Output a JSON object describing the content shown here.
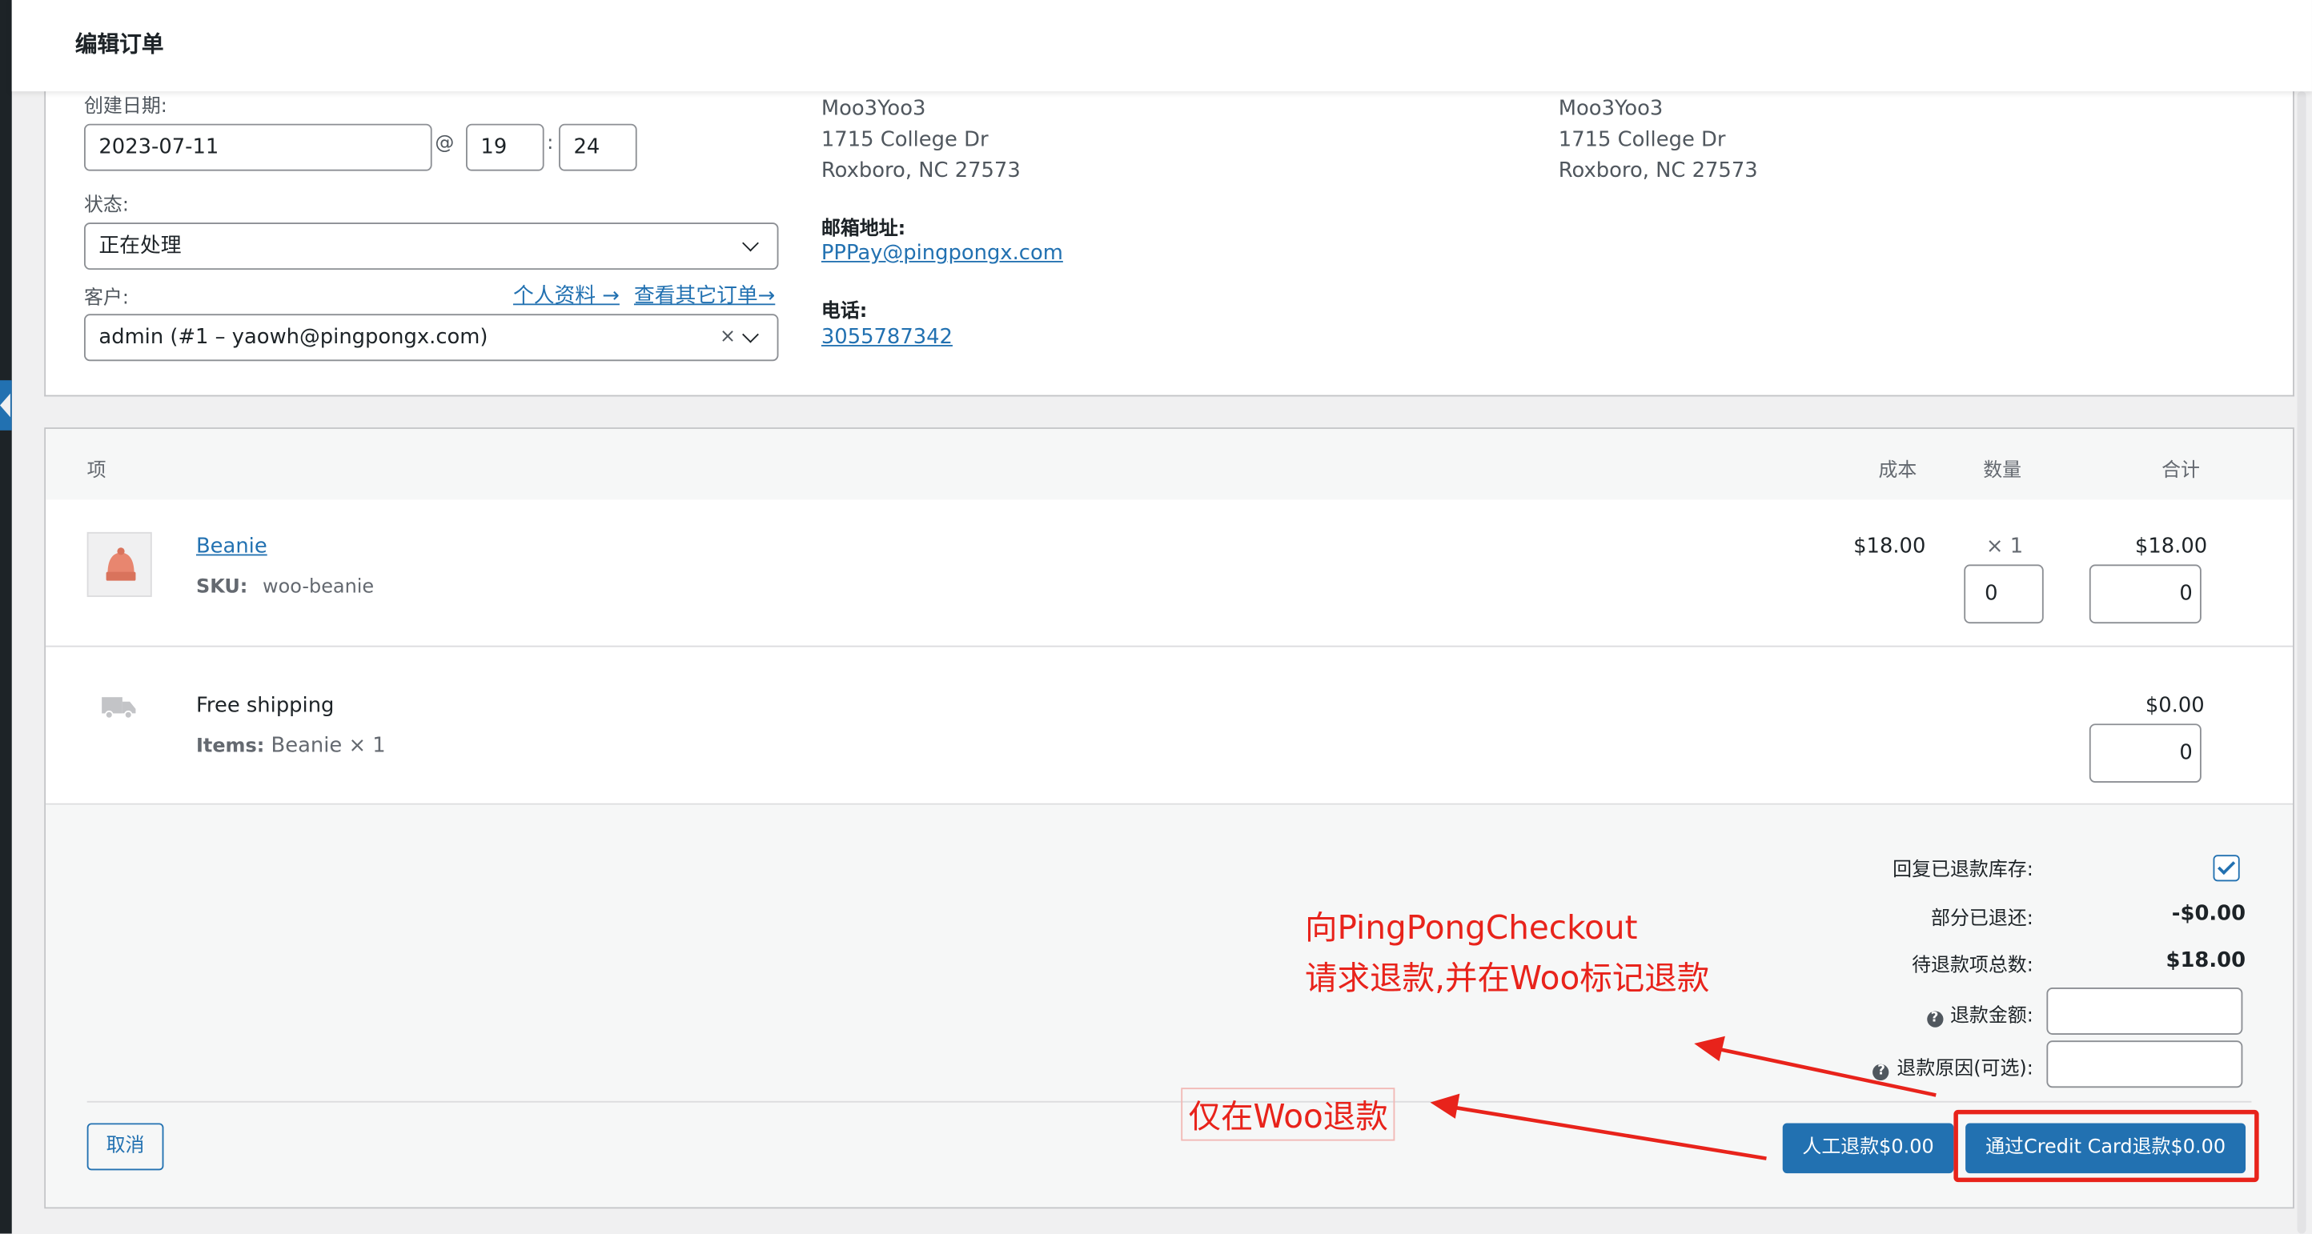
{
  "header": {
    "title": "编辑订单"
  },
  "general": {
    "created_label": "创建日期:",
    "date_value": "2023-07-11",
    "at_sign": "@",
    "hour": "19",
    "colon": ":",
    "minute": "24",
    "status_label": "状态:",
    "status_value": "正在处理",
    "customer_label": "客户:",
    "profile_link": "个人资料 →",
    "other_orders_link": "查看其它订单→",
    "customer_value": "admin (#1 – yaowh@pingpongx.com)",
    "clear_glyph": "×"
  },
  "billing": {
    "name": "Moo3Yoo3",
    "street": "1715 College Dr",
    "city": "Roxboro, NC 27573",
    "email_label": "邮箱地址:",
    "email": "PPPay@pingpongx.com",
    "phone_label": "电话:",
    "phone": "3055787342"
  },
  "shipping": {
    "name": "Moo3Yoo3",
    "street": "1715 College Dr",
    "city": "Roxboro, NC 27573"
  },
  "items": {
    "headers": {
      "item": "项",
      "cost": "成本",
      "qty": "数量",
      "total": "合计"
    },
    "product": {
      "name": "Beanie",
      "sku_label": "SKU:",
      "sku": "woo-beanie",
      "cost": "$18.00",
      "qty": "× 1",
      "total": "$18.00",
      "refund_qty": "0",
      "refund_total": "0"
    },
    "shipping_line": {
      "name": "Free shipping",
      "items_label": "Items:",
      "items_value": "Beanie × 1",
      "total": "$0.00",
      "refund_total": "0"
    }
  },
  "refund": {
    "restock_label": "回复已退款库存:",
    "restock_checked": true,
    "refunded_label": "部分已退还:",
    "refunded_value": "-$0.00",
    "available_label": "待退款项总数:",
    "available_value": "$18.00",
    "amount_label": "退款金额:",
    "amount_value": "",
    "reason_label": "退款原因(可选):",
    "reason_value": "",
    "help_glyph": "?",
    "cancel_button": "取消",
    "manual_button": "人工退款$0.00",
    "gateway_button": "通过Credit Card退款$0.00"
  },
  "annotations": {
    "line1": "向PingPongCheckout",
    "line2": "请求退款,并在Woo标记退款",
    "woo_only": "仅在Woo退款",
    "color": "#e8231b"
  },
  "colors": {
    "accent": "#2271b1",
    "annotation_red": "#e8231b",
    "admin_bar": "#1d2327"
  }
}
